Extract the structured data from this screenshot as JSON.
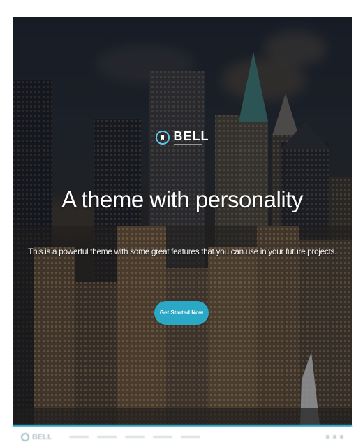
{
  "hero": {
    "brand": "BELL",
    "headline": "A theme with personality",
    "subline": "This is a powerful theme with some great features that you can use in your future projects.",
    "cta_label": "Get Started Now"
  },
  "navbar": {
    "brand": "BELL"
  },
  "colors": {
    "accent": "#2aa8c6",
    "logo_ring": "#5ec9e6",
    "text_light": "#ffffff"
  },
  "icons": {
    "logo": "bell-logo-icon",
    "nav_logo": "bell-logo-icon",
    "social": [
      "facebook-icon",
      "twitter-icon",
      "google-plus-icon"
    ]
  }
}
